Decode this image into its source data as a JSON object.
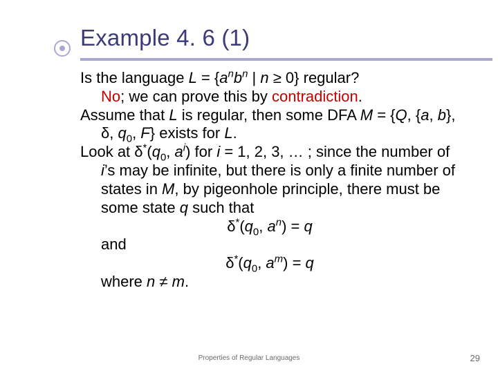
{
  "title_number": "Example 4. 6 (1)",
  "body": {
    "line1_pre": "Is the language ",
    "line1_set_open": " = {",
    "line1_set_bar": " | ",
    "line1_set_close": " 0} regular?",
    "L": "L",
    "a": "a",
    "b": "b",
    "n": "n",
    "geq": "≥",
    "line2_pre": "No",
    "line2_rest1": "; we can prove this by ",
    "line2_contradiction": "contradiction",
    "line2_rest2": ".",
    "line3_a": "Assume that ",
    "line3_b": " is regular, then some DFA ",
    "M": "M",
    "line3_c": " = {",
    "Q": "Q",
    "line3_d": ", {",
    "comma": ", ",
    "line3_e": "}, ",
    "delta": "δ",
    "line3_f": ", ",
    "q": "q",
    "zero": "0",
    "line3_g": ", ",
    "F": "F",
    "line3_h": "} exists for ",
    "line3_i": ".",
    "line4_a": "Look at ",
    "star": "*",
    "line4_b": "(",
    "line4_c": ", ",
    "i": "i",
    "line4_d": ") for ",
    "line4_e": " = 1, 2, 3, … ; since the number of ",
    "line4_f": "’s may be infinite, but there is only a finite number of states in ",
    "line4_g": ", by pigeonhole principle, there must be some state ",
    "line4_h": " such that",
    "eq1_open": "(",
    "eq1_mid": ", ",
    "eq1_close": ") = ",
    "and": "and",
    "m": "m",
    "where_a": "where ",
    "neq": "≠",
    "where_b": ".",
    "space": " "
  },
  "footer": "Properties of Regular Languages",
  "pagenum": "29"
}
